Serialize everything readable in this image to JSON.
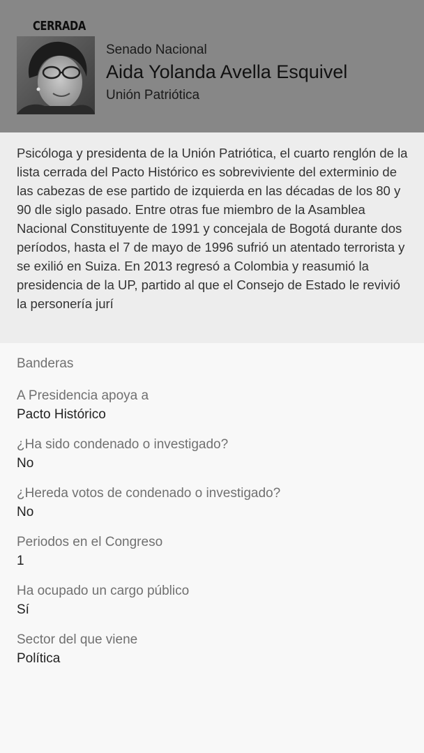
{
  "header": {
    "badge": "CERRADA",
    "chamber": "Senado Nacional",
    "name": "Aida Yolanda Avella Esquivel",
    "party": "Unión Patriótica",
    "photo_alt": "candidate-photo",
    "background_color": "#878787"
  },
  "bio": {
    "text": "Psicóloga y presidenta de la Unión Patriótica, el cuarto renglón de la lista cerrada del Pacto Histórico es sobreviviente del exterminio de las cabezas de ese partido de izquierda en las décadas de los 80 y 90 dle siglo pasado. Entre otras fue miembro de la Asamblea Nacional Constituyente de 1991 y concejala de Bogotá durante dos períodos, hasta el 7 de mayo de 1996 sufrió un atentado terrorista y se exilió en Suiza. En 2013 regresó a Colombia y reasumió la presidencia de la UP, partido al que el Consejo de Estado le revivió la personería jurí"
  },
  "details": {
    "section_title": "Banderas",
    "fields": [
      {
        "label": "A Presidencia apoya a",
        "value": "Pacto Histórico"
      },
      {
        "label": "¿Ha sido condenado o investigado?",
        "value": "No"
      },
      {
        "label": "¿Hereda votos de condenado o investigado?",
        "value": "No"
      },
      {
        "label": "Periodos en el Congreso",
        "value": "1"
      },
      {
        "label": "Ha ocupado un cargo público",
        "value": "Sí"
      },
      {
        "label": "Sector del que viene",
        "value": "Política"
      }
    ]
  }
}
